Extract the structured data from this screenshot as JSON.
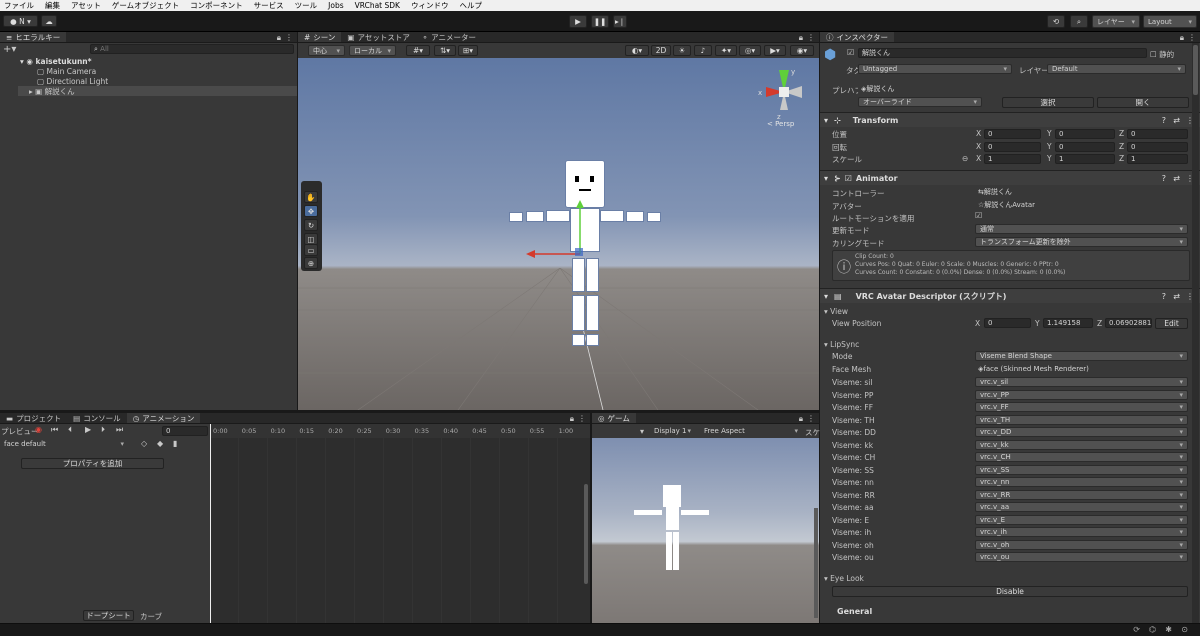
{
  "menu": [
    "ファイル",
    "編集",
    "アセット",
    "ゲームオブジェクト",
    "コンポーネント",
    "サービス",
    "ツール",
    "Jobs",
    "VRChat SDK",
    "ウィンドウ",
    "ヘルプ"
  ],
  "toolbar": {
    "account": "N",
    "layers": "レイヤー",
    "layout": "Layout"
  },
  "hierarchy": {
    "tab": "ヒエラルキー",
    "search_placeholder": "All",
    "scene": "kaisetukunn*",
    "items": [
      "Main Camera",
      "Directional Light",
      "解説くん"
    ]
  },
  "scene": {
    "tabs": [
      "シーン",
      "アセットストア",
      "アニメーター"
    ],
    "pivot": "中心",
    "space": "ローカル",
    "mode2d": "2D",
    "persp": "< Persp"
  },
  "bottom_tabs": [
    "プロジェクト",
    "コンソール",
    "アニメーション"
  ],
  "animation": {
    "preview": "プレビュー",
    "frame": "0",
    "clip": "face default",
    "add_property": "プロパティを追加",
    "dopesheet": "ドープシート",
    "curves": "カーブ",
    "ticks": [
      "0:00",
      "0:05",
      "0:10",
      "0:15",
      "0:20",
      "0:25",
      "0:30",
      "0:35",
      "0:40",
      "0:45",
      "0:50",
      "0:55",
      "1:00"
    ]
  },
  "game": {
    "tab": "ゲーム",
    "display": "Display 1",
    "aspect": "Free Aspect",
    "scale": "スケ"
  },
  "inspector": {
    "tab": "インスペクター",
    "name": "解説くん",
    "static": "静的",
    "tag_label": "タグ",
    "tag": "Untagged",
    "layer_label": "レイヤー",
    "layer": "Default",
    "prefab_label": "プレハブ",
    "prefab": "解説くん",
    "overrides": "オーバーライド",
    "select": "選択",
    "open": "開く",
    "transform": {
      "title": "Transform",
      "rows": [
        {
          "label": "位置",
          "x": "0",
          "y": "0",
          "z": "0"
        },
        {
          "label": "回転",
          "x": "0",
          "y": "0",
          "z": "0"
        },
        {
          "label": "スケール",
          "x": "1",
          "y": "1",
          "z": "1"
        }
      ]
    },
    "animator": {
      "title": "Animator",
      "controller_label": "コントローラー",
      "controller": "解説くん",
      "avatar_label": "アバター",
      "avatar": "解説くんAvatar",
      "root_motion": "ルートモーションを適用",
      "update_label": "更新モード",
      "update": "通常",
      "culling_label": "カリングモード",
      "culling": "トランスフォーム更新を除外",
      "info": [
        "Clip Count: 0",
        "Curves Pos: 0 Quat: 0 Euler: 0 Scale: 0 Muscles: 0 Generic: 0 PPtr: 0",
        "Curves Count: 0 Constant: 0 (0.0%) Dense: 0 (0.0%) Stream: 0 (0.0%)"
      ]
    },
    "vrc": {
      "title": "VRC Avatar Descriptor (スクリプト)",
      "view": "View",
      "view_pos_label": "View Position",
      "vx": "0",
      "vy": "1.149158",
      "vz": "0.06902881",
      "edit": "Edit",
      "lipsync": "LipSync",
      "mode_label": "Mode",
      "mode": "Viseme Blend Shape",
      "facemesh_label": "Face Mesh",
      "facemesh": "face (Skinned Mesh Renderer)",
      "visemes": [
        {
          "label": "Viseme: sil",
          "value": "vrc.v_sil"
        },
        {
          "label": "Viseme: PP",
          "value": "vrc.v_PP"
        },
        {
          "label": "Viseme: FF",
          "value": "vrc.v_FF"
        },
        {
          "label": "Viseme: TH",
          "value": "vrc.v_TH"
        },
        {
          "label": "Viseme: DD",
          "value": "vrc.v_DD"
        },
        {
          "label": "Viseme: kk",
          "value": "vrc.v_kk"
        },
        {
          "label": "Viseme: CH",
          "value": "vrc.v_CH"
        },
        {
          "label": "Viseme: SS",
          "value": "vrc.v_SS"
        },
        {
          "label": "Viseme: nn",
          "value": "vrc.v_nn"
        },
        {
          "label": "Viseme: RR",
          "value": "vrc.v_RR"
        },
        {
          "label": "Viseme: aa",
          "value": "vrc.v_aa"
        },
        {
          "label": "Viseme: E",
          "value": "vrc.v_E"
        },
        {
          "label": "Viseme: ih",
          "value": "vrc.v_ih"
        },
        {
          "label": "Viseme: oh",
          "value": "vrc.v_oh"
        },
        {
          "label": "Viseme: ou",
          "value": "vrc.v_ou"
        }
      ],
      "eyelook": "Eye Look",
      "disable": "Disable",
      "general": "General"
    }
  },
  "axes": {
    "x": "x",
    "y": "y",
    "z": "z"
  },
  "colors": {
    "accent": "#2c5d87",
    "sky_top": "#5f78a4",
    "sky_bottom": "#aab4c6",
    "ground": "#6b6663"
  }
}
